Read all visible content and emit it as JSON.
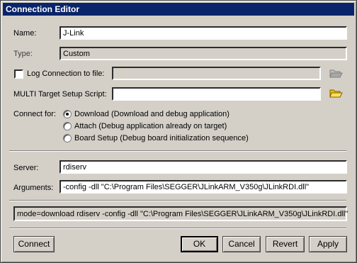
{
  "window": {
    "title": "Connection Editor"
  },
  "name": {
    "label": "Name:",
    "value": "J-Link"
  },
  "type": {
    "label": "Type:",
    "value": "Custom"
  },
  "log": {
    "label": "Log Connection to file:",
    "checked": false,
    "value": ""
  },
  "setup_script": {
    "label": "MULTI Target Setup Script:",
    "value": ""
  },
  "connect_for": {
    "label": "Connect for:",
    "options": [
      {
        "label": "Download (Download and debug application)",
        "selected": true
      },
      {
        "label": "Attach (Debug application already on target)",
        "selected": false
      },
      {
        "label": "Board Setup (Debug board initialization sequence)",
        "selected": false
      }
    ]
  },
  "server": {
    "label": "Server:",
    "value": "rdiserv"
  },
  "arguments": {
    "label": "Arguments:",
    "value": "-config -dll \"C:\\Program Files\\SEGGER\\JLinkARM_V350g\\JLinkRDI.dll\""
  },
  "command_line": "mode=download rdiserv -config -dll \"C:\\Program Files\\SEGGER\\JLinkARM_V350g\\JLinkRDI.dll\"",
  "buttons": {
    "connect": "Connect",
    "ok": "OK",
    "cancel": "Cancel",
    "revert": "Revert",
    "apply": "Apply"
  },
  "icons": {
    "log_folder": "folder-open-icon",
    "script_folder": "folder-open-icon"
  }
}
